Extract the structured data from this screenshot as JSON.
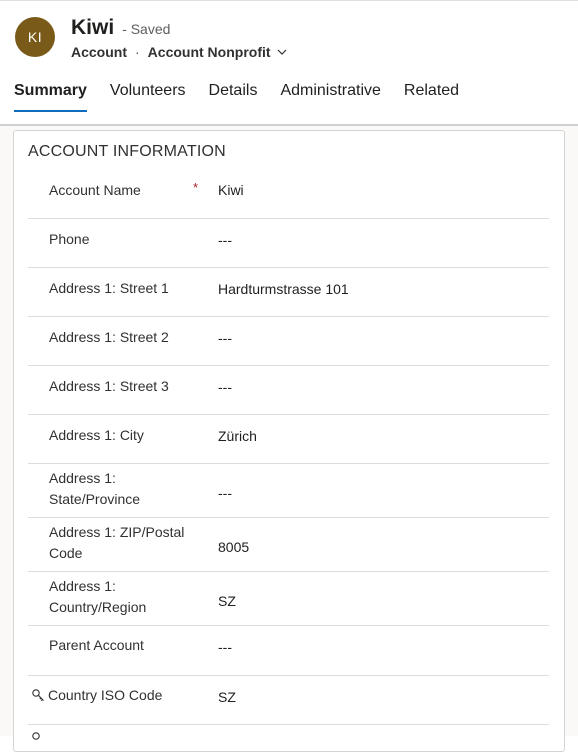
{
  "header": {
    "avatar_initials": "KI",
    "record_title": "Kiwi",
    "saved_status": "- Saved",
    "entity": "Account",
    "separator": "·",
    "form_name": "Account Nonprofit"
  },
  "tabs": [
    {
      "label": "Summary",
      "active": true
    },
    {
      "label": "Volunteers"
    },
    {
      "label": "Details"
    },
    {
      "label": "Administrative"
    },
    {
      "label": "Related"
    }
  ],
  "section": {
    "title": "ACCOUNT INFORMATION",
    "fields": [
      {
        "label": "Account Name",
        "value": "Kiwi",
        "required": "*"
      },
      {
        "label": "Phone",
        "value": "---"
      },
      {
        "label": "Address 1: Street 1",
        "value": "Hardturmstrasse 101"
      },
      {
        "label": "Address 1: Street 2",
        "value": "---"
      },
      {
        "label": "Address 1: Street 3",
        "value": "---"
      },
      {
        "label": "Address 1: City",
        "value": "Zürich"
      },
      {
        "label": "Address 1: State/Province",
        "value": "---"
      },
      {
        "label": "Address 1: ZIP/Postal Code",
        "value": "8005"
      },
      {
        "label": "Address 1: Country/Region",
        "value": "SZ"
      },
      {
        "label": "Parent Account",
        "value": "---"
      },
      {
        "label": "Country ISO Code",
        "value": "SZ",
        "icon": "lock-icon"
      }
    ]
  },
  "colors": {
    "accent": "#0f6cbd",
    "avatar": "#7a5a18",
    "required": "#a4262c"
  }
}
